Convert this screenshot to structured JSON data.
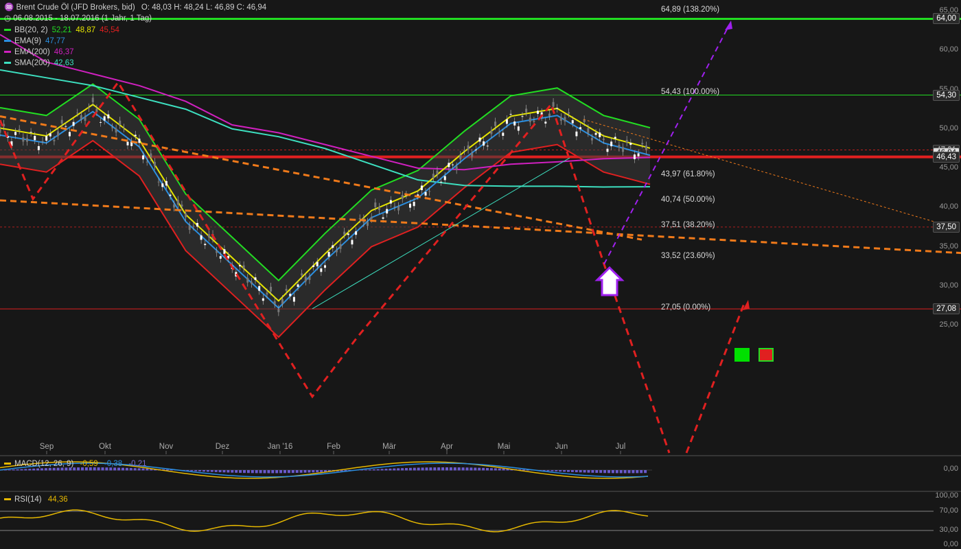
{
  "header": {
    "title": "Brent Crude Öl (JFD Brokers, bid)",
    "ohlc": "O: 48,03  H: 48,24  L: 46,89  C: 46,94",
    "range": "06.08.2015 - 18.07.2016 (1 Jahr, 1 Tag)",
    "legend": [
      {
        "label": "BB(20, 2)",
        "values": [
          "52,21",
          "48,87",
          "45,54"
        ],
        "colors": [
          "#22dd22",
          "#e6e600",
          "#e02020"
        ]
      },
      {
        "label": "EMA(9)",
        "values": [
          "47,77"
        ],
        "colors": [
          "#2b8fe0"
        ]
      },
      {
        "label": "EMA(200)",
        "values": [
          "46,37"
        ],
        "colors": [
          "#d020c0"
        ]
      },
      {
        "label": "SMA(200)",
        "values": [
          "42,63"
        ],
        "colors": [
          "#3de0c0"
        ]
      }
    ]
  },
  "y_axis": [
    "65,00",
    "60,00",
    "55,00",
    "50,00",
    "45,00",
    "40,00",
    "35,00",
    "30,00",
    "25,00"
  ],
  "price_tags": [
    {
      "label": "64,00",
      "value": 64.0
    },
    {
      "label": "54,30",
      "value": 54.3
    },
    {
      "label": "47,31",
      "value": 47.31
    },
    {
      "label": "46,94",
      "value": 46.94,
      "current": true
    },
    {
      "label": "46,43",
      "value": 46.43
    },
    {
      "label": "37,50",
      "value": 37.5
    },
    {
      "label": "27,08",
      "value": 27.08
    }
  ],
  "fib_levels": [
    {
      "label": "64,89 (138.20%)",
      "value": 64.89
    },
    {
      "label": "54,43 (100.00%)",
      "value": 54.43
    },
    {
      "label": "43,97 (61.80%)",
      "value": 43.97
    },
    {
      "label": "40,74 (50.00%)",
      "value": 40.74
    },
    {
      "label": "37,51 (38.20%)",
      "value": 37.51
    },
    {
      "label": "33,52 (23.60%)",
      "value": 33.52
    },
    {
      "label": "27,05 (0.00%)",
      "value": 27.05
    }
  ],
  "months": [
    "Sep",
    "Okt",
    "Nov",
    "Dez",
    "Jan '16",
    "Feb",
    "Mär",
    "Apr",
    "Mai",
    "Jun",
    "Jul"
  ],
  "macd": {
    "label": "MACD(12, 26, 9)",
    "values": [
      "-0,59",
      "-0,38",
      "-0,21"
    ],
    "axis": [
      "0,00"
    ]
  },
  "rsi": {
    "label": "RSI(14)",
    "value": "44,36",
    "axis": [
      "100,00",
      "70,00",
      "30,00",
      "0,00"
    ]
  },
  "colors": {
    "bg": "#171717",
    "green": "#22dd22",
    "red": "#e02020",
    "orange": "#f07a1a",
    "purple": "#a020f0",
    "yellow": "#e6e600",
    "blue": "#2b8fe0",
    "magenta": "#d020c0",
    "teal": "#3de0c0"
  },
  "chart_data": {
    "type": "line",
    "title": "Brent Crude Öl (JFD Brokers, bid)",
    "x": [
      "2015-08",
      "2015-09",
      "2015-10",
      "2015-11",
      "2015-12",
      "2016-01",
      "2016-01-20",
      "2016-02",
      "2016-03",
      "2016-04",
      "2016-05",
      "2016-06",
      "2016-06-10",
      "2016-07",
      "2016-07-18"
    ],
    "series": [
      {
        "name": "Brent Crude Öl (JFD Brokers, bid)",
        "values": [
          49.5,
          48.5,
          52.5,
          48.0,
          38.5,
          33.0,
          27.5,
          33.5,
          39.0,
          41.5,
          46.5,
          51.0,
          52.0,
          48.5,
          46.94
        ]
      },
      {
        "name": "SMA(200)",
        "values": [
          57.5,
          56.5,
          55.5,
          54.0,
          52.5,
          50.0,
          49.0,
          47.5,
          45.5,
          43.5,
          42.8,
          42.7,
          42.7,
          42.6,
          42.63
        ]
      },
      {
        "name": "EMA(200)",
        "values": [
          62.0,
          58.5,
          57.0,
          55.5,
          53.5,
          50.5,
          49.5,
          48.0,
          46.5,
          45.0,
          44.8,
          45.5,
          45.8,
          46.2,
          46.37
        ]
      }
    ],
    "ylim": [
      22.0,
      65.5
    ]
  }
}
